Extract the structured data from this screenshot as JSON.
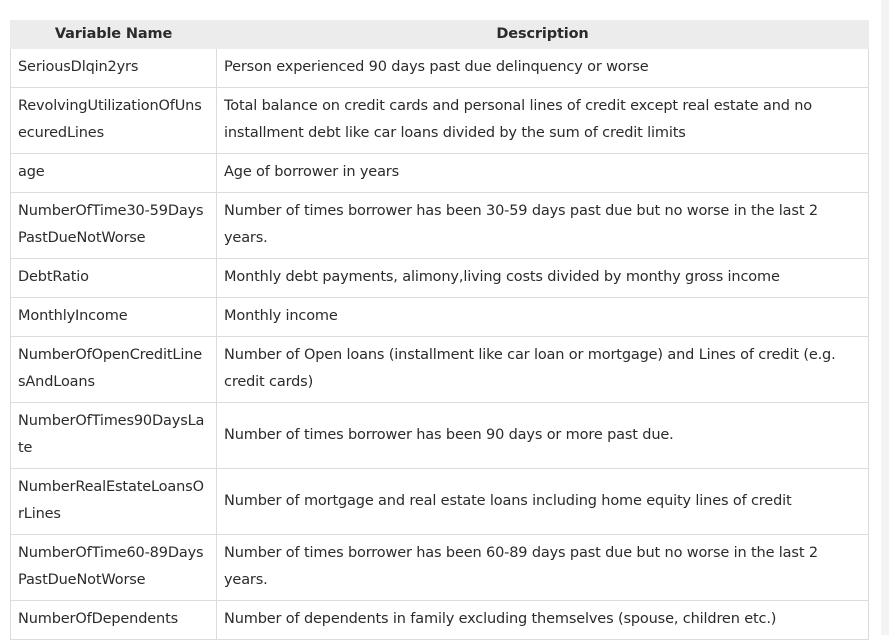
{
  "table": {
    "headers": [
      "Variable Name",
      "Description"
    ],
    "rows": [
      {
        "name": "SeriousDlqin2yrs",
        "description": "Person experienced 90 days past due delinquency or worse"
      },
      {
        "name": "RevolvingUtilizationOfUnsecuredLines",
        "description": "Total balance on credit cards and personal lines of credit except real estate and no installment debt like car loans divided by the sum of credit limits"
      },
      {
        "name": "age",
        "description": "Age of borrower in years"
      },
      {
        "name": "NumberOfTime30-59DaysPastDueNotWorse",
        "description": "Number of times borrower has been 30-59 days past due but no worse in the last 2 years."
      },
      {
        "name": "DebtRatio",
        "description": "Monthly debt payments, alimony,living costs divided by monthy gross income"
      },
      {
        "name": "MonthlyIncome",
        "description": "Monthly income"
      },
      {
        "name": "NumberOfOpenCreditLinesAndLoans",
        "description": "Number of Open loans (installment like car loan or mortgage) and Lines of credit (e.g. credit cards)"
      },
      {
        "name": "NumberOfTimes90DaysLate",
        "description": "Number of times borrower has been 90 days or more past due."
      },
      {
        "name": "NumberRealEstateLoansOrLines",
        "description": "Number of mortgage and real estate loans including home equity lines of credit"
      },
      {
        "name": "NumberOfTime60-89DaysPastDueNotWorse",
        "description": "Number of times borrower has been 60-89 days past due but no worse in the last 2 years."
      },
      {
        "name": "NumberOfDependents",
        "description": "Number of dependents in family excluding themselves (spouse, children etc.)"
      }
    ]
  }
}
